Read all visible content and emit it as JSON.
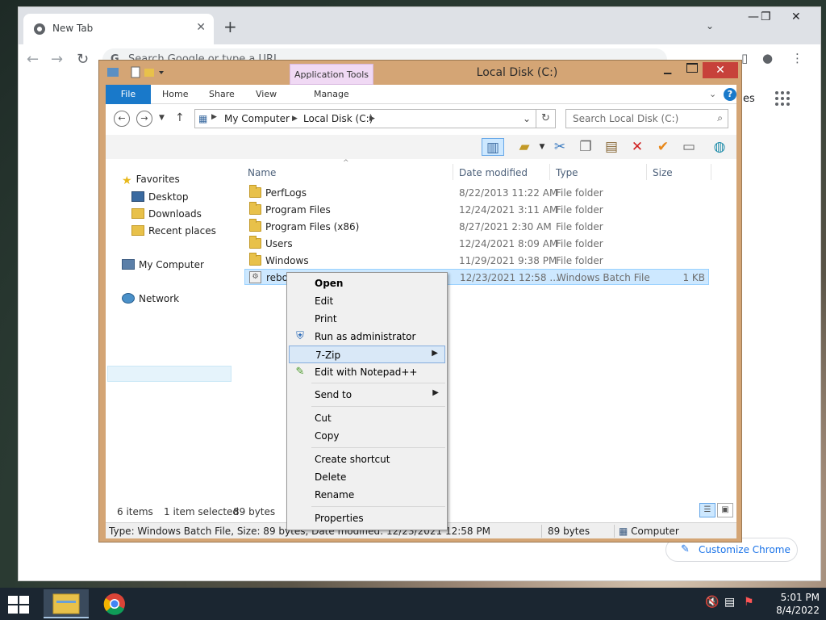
{
  "chrome": {
    "tab_title": "New Tab",
    "tab_close": "✕",
    "new_tab": "+",
    "omnibox_placeholder": "Search Google or type a URL",
    "side_label": "es",
    "customize_label": "Customize Chrome",
    "window_controls": [
      "—",
      "❐",
      "✕"
    ]
  },
  "explorer": {
    "title": "Local Disk (C:)",
    "app_tools": "Application Tools",
    "ribbon_tabs": [
      "File",
      "Home",
      "Share",
      "View",
      "Manage"
    ],
    "address": {
      "crumbs": [
        "My Computer",
        "Local Disk (C:)"
      ]
    },
    "search_placeholder": "Search Local Disk (C:)",
    "nav": {
      "favorites": "Favorites",
      "desktop": "Desktop",
      "downloads": "Downloads",
      "recent": "Recent places",
      "my_computer": "My Computer",
      "network": "Network"
    },
    "columns": [
      "Name",
      "Date modified",
      "Type",
      "Size"
    ],
    "rows": [
      {
        "name": "PerfLogs",
        "date": "8/22/2013 11:22 AM",
        "type": "File folder",
        "size": ""
      },
      {
        "name": "Program Files",
        "date": "12/24/2021 3:11 AM",
        "type": "File folder",
        "size": ""
      },
      {
        "name": "Program Files (x86)",
        "date": "8/27/2021 2:30 AM",
        "type": "File folder",
        "size": ""
      },
      {
        "name": "Users",
        "date": "12/24/2021 8:09 AM",
        "type": "File folder",
        "size": ""
      },
      {
        "name": "Windows",
        "date": "11/29/2021 9:38 PM",
        "type": "File folder",
        "size": ""
      },
      {
        "name": "rebo",
        "date": "12/23/2021 12:58 ...",
        "type": "Windows Batch File",
        "size": "1 KB"
      }
    ],
    "status": {
      "items": "6 items",
      "selected": "1 item selected",
      "bytes": "89 bytes",
      "details": "Type: Windows Batch File, Size: 89 bytes, Date modified: 12/23/2021 12:58 PM",
      "size": "89 bytes",
      "location": "Computer"
    }
  },
  "context_menu": {
    "open": "Open",
    "edit": "Edit",
    "print": "Print",
    "run_admin": "Run as administrator",
    "seven_zip": "7-Zip",
    "notepad": "Edit with Notepad++",
    "send_to": "Send to",
    "cut": "Cut",
    "copy": "Copy",
    "create_shortcut": "Create shortcut",
    "delete": "Delete",
    "rename": "Rename",
    "properties": "Properties"
  },
  "taskbar": {
    "time": "5:01 PM",
    "date": "8/4/2022"
  },
  "colors": {
    "explorer_frame": "#d4a575",
    "file_tab": "#1979ca",
    "close_button": "#c7413a",
    "selection": "#cde8ff",
    "app_tools": "#f0d9f4"
  }
}
